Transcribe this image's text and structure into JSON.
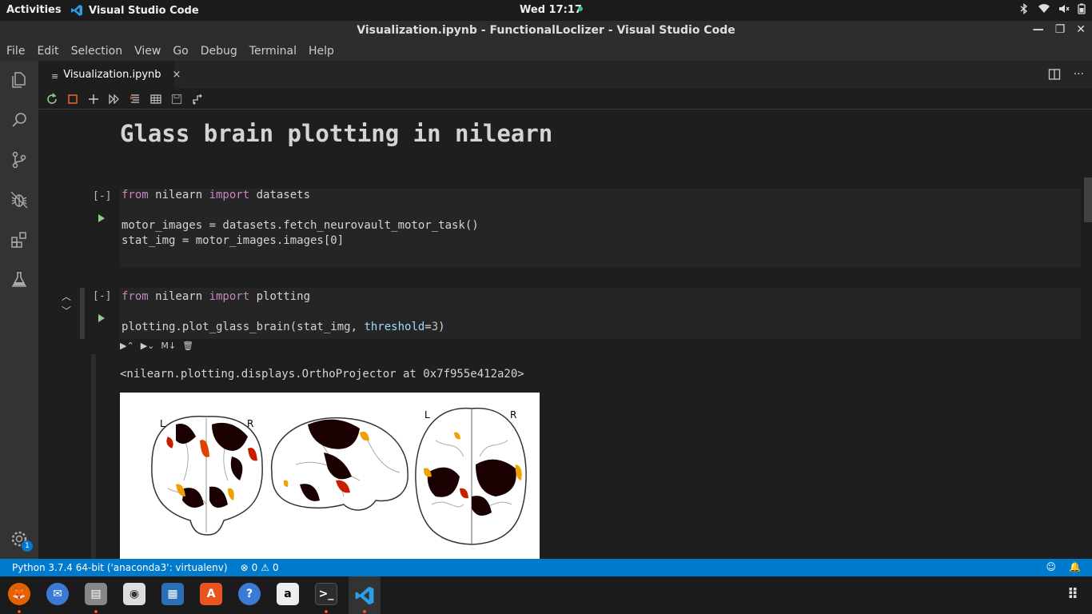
{
  "topbar": {
    "activities": "Activities",
    "app_name": "Visual Studio Code",
    "clock": "Wed 17:17"
  },
  "window": {
    "title": "Visualization.ipynb - FunctionalLoclizer - Visual Studio Code"
  },
  "menu": [
    "File",
    "Edit",
    "Selection",
    "View",
    "Go",
    "Debug",
    "Terminal",
    "Help"
  ],
  "tab": {
    "label": "Visualization.ipynb",
    "close": "×"
  },
  "notebook": {
    "heading": "Glass brain plotting in nilearn",
    "cell1": {
      "exec": "[-]",
      "line1_kw1": "from",
      "line1_mod": " nilearn ",
      "line1_kw2": "import",
      "line1_rest": " datasets",
      "line2": "motor_images = datasets.fetch_neurovault_motor_task()",
      "line3": "stat_img = motor_images.images[0]"
    },
    "cell2": {
      "exec": "[-]",
      "line1_kw1": "from",
      "line1_mod": " nilearn ",
      "line1_kw2": "import",
      "line1_rest": " plotting",
      "line2_a": "plotting.plot_glass_brain(stat_img, ",
      "line2_param": "threshold",
      "line2_eq": "=",
      "line2_num": "3",
      "line2_end": ")",
      "md_label": "M↓",
      "output": "<nilearn.plotting.displays.OrthoProjector at 0x7f955e412a20>"
    },
    "plot_labels": {
      "l1": "L",
      "r1": "R",
      "l2": "L",
      "r2": "R"
    }
  },
  "statusbar": {
    "interpreter": "Python 3.7.4 64-bit ('anaconda3': virtualenv)",
    "errors": "0",
    "warnings": "0"
  },
  "activitybar": {
    "badge": "1"
  },
  "colors": {
    "accent": "#007acc",
    "run": "#89d185",
    "keyword": "#c586c0",
    "param": "#9cdcfe"
  }
}
